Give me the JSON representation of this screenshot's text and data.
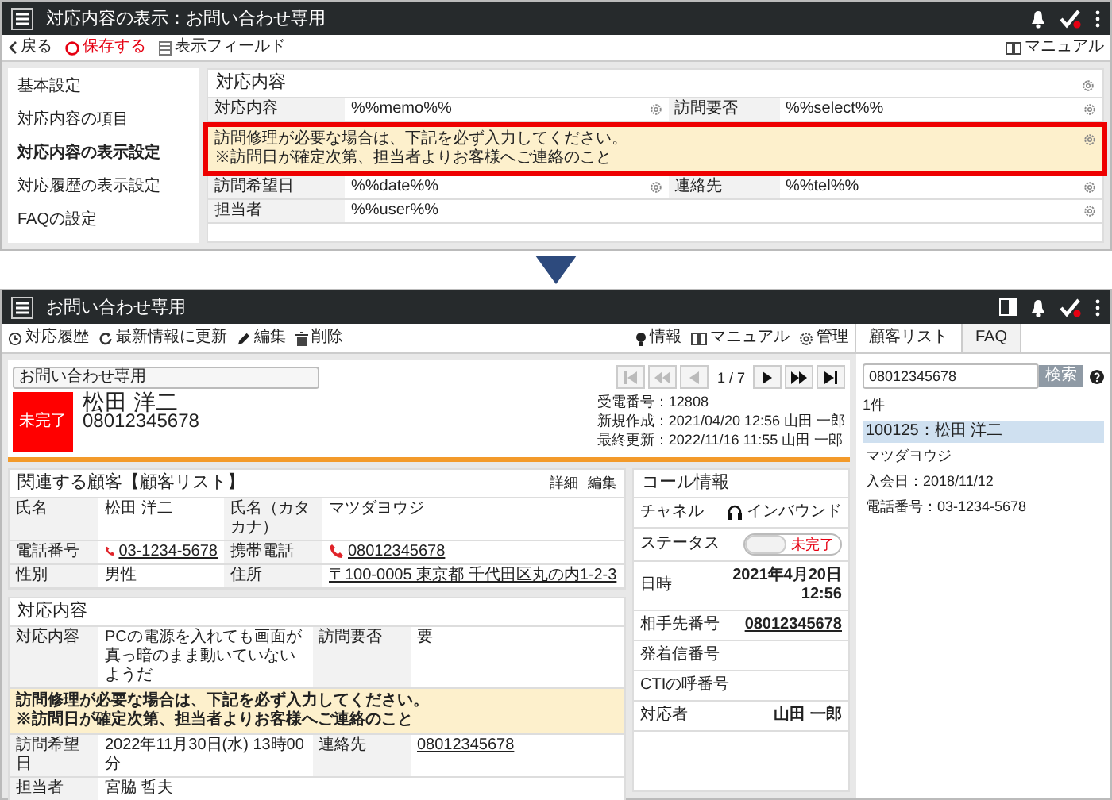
{
  "top_screen": {
    "title": "対応内容の表示：お問い合わせ専用",
    "toolbar": {
      "back": "戻る",
      "save": "保存する",
      "fields": "表示フィールド",
      "manual": "マニュアル"
    },
    "sidebar": [
      {
        "label": "基本設定",
        "selected": false
      },
      {
        "label": "対応内容の項目",
        "selected": false
      },
      {
        "label": "対応内容の表示設定",
        "selected": true
      },
      {
        "label": "対応履歴の表示設定",
        "selected": false
      },
      {
        "label": "FAQの設定",
        "selected": false
      }
    ],
    "section_title": "対応内容",
    "rows": [
      {
        "kind": "pair",
        "cells": [
          {
            "label": "対応内容",
            "value": "%%memo%%"
          },
          {
            "label": "訪問要否",
            "value": "%%select%%"
          }
        ]
      },
      {
        "kind": "notice",
        "highlighted": true,
        "lines": [
          "訪問修理が必要な場合は、下記を必ず入力してください。",
          "※訪問日が確定次第、担当者よりお客様へご連絡のこと"
        ]
      },
      {
        "kind": "pair",
        "cells": [
          {
            "label": "訪問希望日",
            "value": "%%date%%"
          },
          {
            "label": "連絡先",
            "value": "%%tel%%"
          }
        ]
      },
      {
        "kind": "single",
        "cells": [
          {
            "label": "担当者",
            "value": "%%user%%"
          }
        ]
      }
    ]
  },
  "bottom_screen": {
    "title": "お問い合わせ専用",
    "actions": [
      {
        "kind": "history",
        "label": "対応履歴"
      },
      {
        "kind": "refresh",
        "label": "最新情報に更新"
      },
      {
        "kind": "edit",
        "label": "編集"
      },
      {
        "kind": "delete",
        "label": "削除"
      }
    ],
    "right_actions": [
      {
        "kind": "info",
        "label": "情報"
      },
      {
        "kind": "manual",
        "label": "マニュアル"
      },
      {
        "kind": "admin",
        "label": "管理"
      }
    ],
    "tabs": [
      {
        "label": "顧客リスト",
        "selected": true
      },
      {
        "label": "FAQ",
        "selected": false
      }
    ],
    "record": {
      "category": "お問い合わせ専用",
      "status": "未完了",
      "name": "松田 洋二",
      "phone": "08012345678",
      "pager": "1 / 7",
      "pager_buttons": [
        {
          "kind": "first",
          "disabled": true
        },
        {
          "kind": "rewind",
          "disabled": true
        },
        {
          "kind": "prev",
          "disabled": true
        },
        {
          "kind": "next",
          "disabled": false
        },
        {
          "kind": "forward",
          "disabled": false
        },
        {
          "kind": "last",
          "disabled": false
        }
      ],
      "meta": [
        "受電番号：12808",
        "新規作成：2021/04/20 12:56 山田 一郎",
        "最終更新：2022/11/16 11:55 山田 一郎"
      ]
    },
    "customer": {
      "title": "関連する顧客【顧客リスト】",
      "links": [
        "詳細",
        "編集"
      ],
      "rows": [
        {
          "kind": "pair",
          "cells": [
            {
              "label": "氏名",
              "value": "松田 洋二",
              "kind": "text"
            },
            {
              "label": "氏名（カタカナ）",
              "value": "マツダヨウジ",
              "kind": "text"
            }
          ]
        },
        {
          "kind": "pair",
          "cells": [
            {
              "label": "電話番号",
              "value": "03-1234-5678",
              "kind": "phone"
            },
            {
              "label": "携帯電話",
              "value": "08012345678",
              "kind": "phone"
            }
          ]
        },
        {
          "kind": "pair",
          "cells": [
            {
              "label": "性別",
              "value": "男性",
              "kind": "text"
            },
            {
              "label": "住所",
              "value": "〒100-0005 東京都 千代田区丸の内1-2-3",
              "kind": "link"
            }
          ]
        }
      ]
    },
    "response": {
      "title": "対応内容",
      "rows": [
        {
          "kind": "pair",
          "cells": [
            {
              "label": "対応内容",
              "value": "PCの電源を入れても画面が真っ暗のまま動いていないようだ",
              "kind": "text"
            },
            {
              "label": "訪問要否",
              "value": "要",
              "kind": "text"
            }
          ]
        },
        {
          "kind": "notice",
          "highlighted": false,
          "lines": [
            "訪問修理が必要な場合は、下記を必ず入力してください。",
            "※訪問日が確定次第、担当者よりお客様へご連絡のこと"
          ]
        },
        {
          "kind": "pair",
          "cells": [
            {
              "label": "訪問希望日",
              "value": "2022年11月30日(水) 13時00分",
              "kind": "text"
            },
            {
              "label": "連絡先",
              "value": "08012345678",
              "kind": "link"
            }
          ]
        },
        {
          "kind": "single",
          "cells": [
            {
              "label": "担当者",
              "value": "宮脇 哲夫",
              "kind": "text"
            }
          ]
        }
      ]
    },
    "call_info": {
      "title": "コール情報",
      "rows": [
        {
          "kind": "channel",
          "label": "チャネル",
          "value": "インバウンド"
        },
        {
          "kind": "toggle",
          "label": "ステータス",
          "value": "未完了",
          "on": false
        },
        {
          "kind": "lines",
          "label": "日時",
          "lines": [
            "2021年4月20日",
            "12:56"
          ]
        },
        {
          "kind": "link",
          "label": "相手先番号",
          "value": "08012345678"
        },
        {
          "kind": "text",
          "label": "発着信番号"
        },
        {
          "kind": "text",
          "label": "CTIの呼番号"
        },
        {
          "kind": "bold",
          "label": "対応者",
          "value": "山田 一郎"
        }
      ]
    },
    "search": {
      "value": "08012345678",
      "button": "検索",
      "count": "1件",
      "results": [
        {
          "title": "100125：松田 洋二",
          "selected": true,
          "details": [
            "マツダヨウジ",
            "入会日：2018/11/12",
            "電話番号：03-1234-5678"
          ]
        }
      ]
    }
  }
}
